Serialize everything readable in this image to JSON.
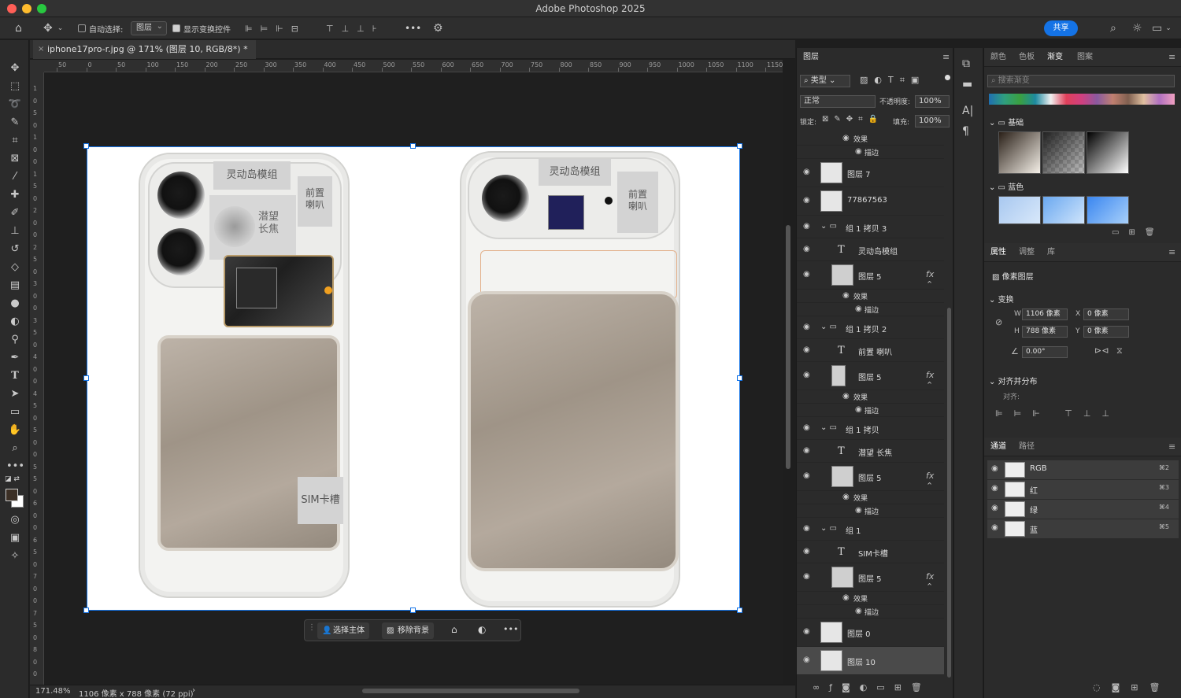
{
  "window": {
    "title": "Adobe Photoshop 2025"
  },
  "options_bar": {
    "auto_select_label": "自动选择:",
    "auto_select_target": "图层",
    "show_transform_label": "显示变换控件",
    "more_label": "•••",
    "share_label": "共享"
  },
  "document": {
    "tab_title": "iphone17pro-r.jpg @ 171% (图层 10, RGB/8*) *",
    "zoom": "171.48%",
    "dimensions": "1106 像素 x 788 像素 (72 ppi)",
    "artwork": {
      "left_labels": {
        "dynamic_island": "灵动岛模组",
        "periscope": "潜望\n长焦",
        "speaker": "前置\n喇叭",
        "sim": "SIM卡槽"
      },
      "right_labels": {
        "dynamic_island": "灵动岛模组",
        "speaker": "前置\n喇叭"
      }
    }
  },
  "rulers": {
    "h_ticks": [
      "50",
      "0",
      "50",
      "100",
      "150",
      "200",
      "250",
      "300",
      "350",
      "400",
      "450",
      "500",
      "550",
      "600",
      "650",
      "700",
      "750",
      "800",
      "850",
      "900",
      "950",
      "1000",
      "1050",
      "1100",
      "1150"
    ],
    "v_ticks": [
      "1",
      "0",
      "5",
      "0",
      "1",
      "0",
      "0",
      "1",
      "5",
      "0",
      "2",
      "0",
      "0",
      "2",
      "5",
      "0",
      "3",
      "0",
      "0",
      "3",
      "5",
      "0",
      "4",
      "0",
      "0",
      "4",
      "5",
      "0",
      "5",
      "0",
      "0",
      "5",
      "5",
      "0",
      "6",
      "0",
      "0",
      "6",
      "5",
      "0",
      "7",
      "0",
      "0",
      "7",
      "5",
      "0",
      "8",
      "0",
      "0"
    ]
  },
  "context_bar": {
    "select_subject": "选择主体",
    "remove_bg": "移除背景",
    "more": "•••"
  },
  "layers_panel": {
    "tab": "图层",
    "filter_kind": "类型",
    "blend_mode": "正常",
    "opacity_label": "不透明度:",
    "opacity_value": "100%",
    "lock_label": "锁定:",
    "fill_label": "填充:",
    "fill_value": "100%",
    "rows": [
      {
        "kind": "effect",
        "name": "效果"
      },
      {
        "kind": "stroke",
        "name": "描边"
      },
      {
        "kind": "layer",
        "name": "图层 7"
      },
      {
        "kind": "layer",
        "name": "77867563"
      },
      {
        "kind": "group",
        "name": "组 1 拷贝 3"
      },
      {
        "kind": "text",
        "name": "灵动岛模组"
      },
      {
        "kind": "layer-fx",
        "name": "图层 5"
      },
      {
        "kind": "effect",
        "name": "效果"
      },
      {
        "kind": "stroke",
        "name": "描边"
      },
      {
        "kind": "group",
        "name": "组 1 拷贝 2"
      },
      {
        "kind": "text",
        "name": "前置 喇叭"
      },
      {
        "kind": "layer-fx",
        "name": "图层 5"
      },
      {
        "kind": "effect",
        "name": "效果"
      },
      {
        "kind": "stroke",
        "name": "描边"
      },
      {
        "kind": "group",
        "name": "组 1 拷贝"
      },
      {
        "kind": "text",
        "name": "潜望 长焦"
      },
      {
        "kind": "layer-fx",
        "name": "图层 5"
      },
      {
        "kind": "effect",
        "name": "效果"
      },
      {
        "kind": "stroke",
        "name": "描边"
      },
      {
        "kind": "group",
        "name": "组 1"
      },
      {
        "kind": "text",
        "name": "SIM卡槽"
      },
      {
        "kind": "layer-fx",
        "name": "图层 5"
      },
      {
        "kind": "effect",
        "name": "效果"
      },
      {
        "kind": "stroke",
        "name": "描边"
      },
      {
        "kind": "layer",
        "name": "图层 0"
      },
      {
        "kind": "layer-selected",
        "name": "图层 10"
      }
    ]
  },
  "gradients_panel": {
    "tabs": [
      "颜色",
      "色板",
      "渐变",
      "图案"
    ],
    "active_tab": "渐变",
    "search_placeholder": "搜索渐变",
    "folder_basic": "基础",
    "folder_blue": "蓝色"
  },
  "properties_panel": {
    "tabs": [
      "属性",
      "调整",
      "库"
    ],
    "active_tab": "属性",
    "layer_type": "像素图层",
    "transform_label": "变换",
    "w_label": "W",
    "w_value": "1106 像素",
    "h_label": "H",
    "h_value": "788 像素",
    "x_label": "X",
    "x_value": "0 像素",
    "y_label": "Y",
    "y_value": "0 像素",
    "angle_value": "0.00°",
    "align_label": "对齐并分布",
    "align_sub": "对齐:"
  },
  "channels_panel": {
    "tabs": [
      "通道",
      "路径"
    ],
    "active_tab": "通道",
    "channels": [
      {
        "name": "RGB",
        "key": "⌘2"
      },
      {
        "name": "红",
        "key": "⌘3"
      },
      {
        "name": "绿",
        "key": "⌘4"
      },
      {
        "name": "蓝",
        "key": "⌘5"
      }
    ]
  },
  "colors": {
    "accent": "#1473e6",
    "panel_bg": "#2b2b2b",
    "canvas_bg": "#1f1f1f"
  }
}
